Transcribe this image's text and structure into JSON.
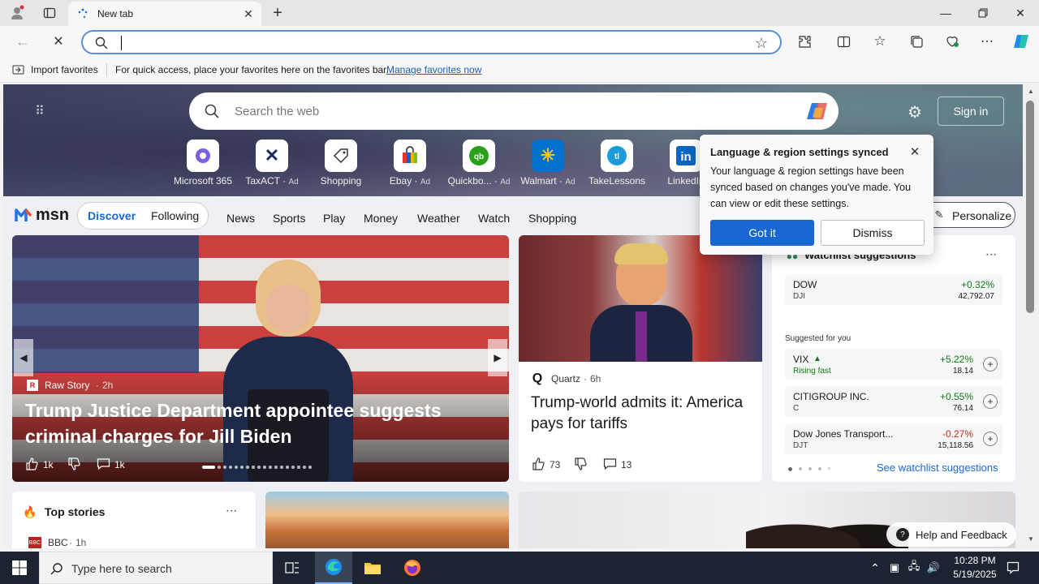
{
  "browser": {
    "tab_title": "New tab",
    "address_value": "",
    "favbar_import": "Import favorites",
    "favbar_text": "For quick access, place your favorites here on the favorites bar.",
    "favbar_link": "Manage favorites now"
  },
  "hero": {
    "search_placeholder": "Search the web",
    "signin": "Sign in",
    "quicklinks": [
      {
        "label": "Microsoft 365",
        "ad": ""
      },
      {
        "label": "TaxACT",
        "ad": "Ad"
      },
      {
        "label": "Shopping",
        "ad": ""
      },
      {
        "label": "Ebay",
        "ad": "Ad"
      },
      {
        "label": "Quickbo...",
        "ad": "Ad"
      },
      {
        "label": "Walmart",
        "ad": "Ad"
      },
      {
        "label": "TakeLessons",
        "ad": ""
      },
      {
        "label": "LinkedIn",
        "ad": ""
      }
    ]
  },
  "nav": {
    "logo": "msn",
    "discover": "Discover",
    "following": "Following",
    "items": [
      "News",
      "Sports",
      "Play",
      "Money",
      "Weather",
      "Watch",
      "Shopping"
    ],
    "personalize": "Personalize"
  },
  "popup": {
    "title": "Language & region settings synced",
    "body": "Your language & region settings have been synced based on changes you've made. You can view or edit these settings.",
    "ok": "Got it",
    "dismiss": "Dismiss"
  },
  "main_story": {
    "source": "Raw Story",
    "time": "2h",
    "headline": "Trump Justice Department appointee suggests criminal charges for Jill Biden",
    "likes": "1k",
    "comments": "1k"
  },
  "second_story": {
    "source": "Quartz",
    "time": "6h",
    "headline": "Trump-world admits it: America pays for tariffs",
    "likes": "73",
    "comments": "13"
  },
  "watchlist": {
    "title": "Watchlist suggestions",
    "top": {
      "name": "DOW",
      "sub": "DJI",
      "change": "+0.32%",
      "price": "42,792.07"
    },
    "suggested_label": "Suggested for you",
    "rows": [
      {
        "name": "VIX",
        "sub": "Rising fast",
        "change": "+5.22%",
        "price": "18.14"
      },
      {
        "name": "CITIGROUP INC.",
        "sub": "C",
        "change": "+0.55%",
        "price": "76.14"
      },
      {
        "name": "Dow Jones Transport...",
        "sub": "DJT",
        "change": "-0.27%",
        "price": "15,118.56"
      }
    ],
    "see_more": "See watchlist suggestions"
  },
  "bottom": {
    "top_stories": "Top stories",
    "bbc": "BBC",
    "bbc_time": "1h",
    "help": "Help and Feedback"
  },
  "taskbar": {
    "search_placeholder": "Type here to search",
    "time": "10:28 PM",
    "date": "5/19/2025"
  },
  "colors": {
    "accent": "#1967d2",
    "positive": "#0f7b0f",
    "negative": "#c42b1c"
  }
}
